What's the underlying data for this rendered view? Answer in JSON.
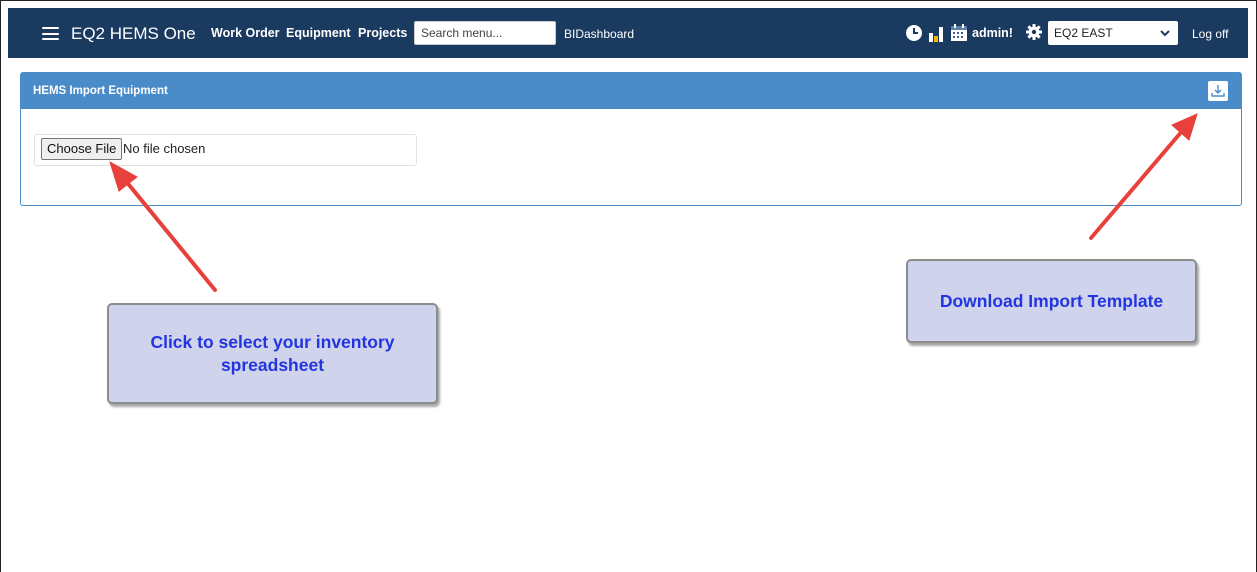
{
  "navbar": {
    "brand": "EQ2 HEMS One",
    "links": [
      "Work Order",
      "Equipment",
      "Projects"
    ],
    "search_placeholder": "Search menu...",
    "bi_link": "BIDashboard",
    "user": "admin!",
    "region": "EQ2 EAST",
    "logoff": "Log off",
    "icons": [
      "menu-icon",
      "clock-icon",
      "chart-icon",
      "calendar-icon",
      "gear-icon",
      "chevron-down-icon"
    ],
    "bg_color": "#1b3a5f"
  },
  "panel": {
    "title": "HEMS Import Equipment",
    "choose_file_label": "Choose File",
    "file_status": "No file chosen",
    "header_color": "#4a8cc9",
    "download_icon": "download-icon"
  },
  "callouts": {
    "left": "Click to select your inventory spreadsheet",
    "right": "Download Import Template",
    "text_color": "#2235e0",
    "bg_color": "#d0d3ec",
    "arrow_color": "#e8413c"
  }
}
